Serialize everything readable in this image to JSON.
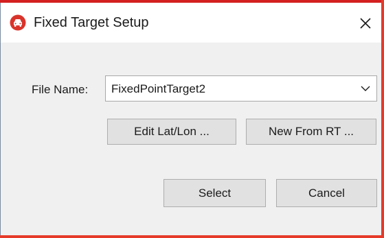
{
  "window": {
    "title": "Fixed Target Setup",
    "app_icon": "red-car-icon",
    "close_icon": "close-icon"
  },
  "form": {
    "file_name_label": "File Name:",
    "file_name_value": "FixedPointTarget2",
    "dropdown_icon": "chevron-down-icon"
  },
  "buttons": {
    "edit_label": "Edit Lat/Lon ...",
    "new_label": "New From RT ...",
    "select_label": "Select",
    "cancel_label": "Cancel"
  },
  "colors": {
    "accent": "#e63a2a",
    "app_icon": "#d9342b"
  }
}
